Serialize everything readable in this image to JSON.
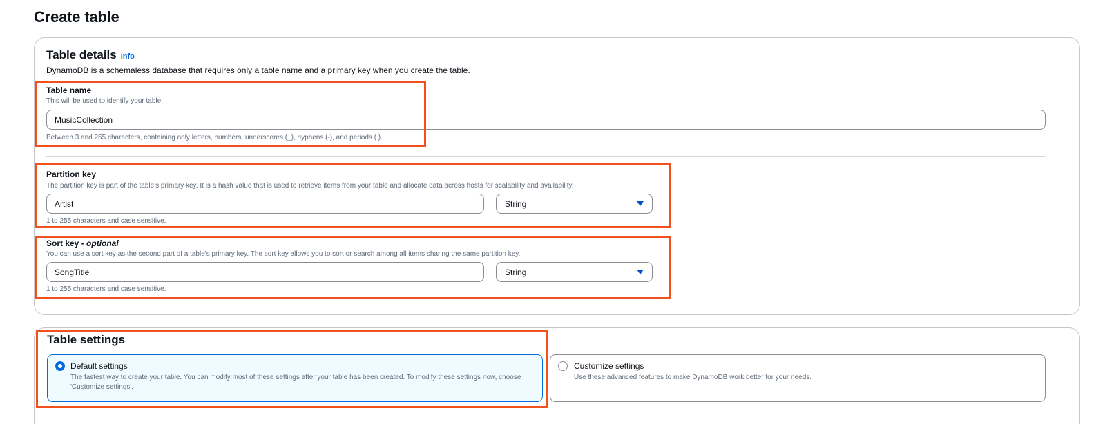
{
  "page": {
    "title": "Create table"
  },
  "table_details": {
    "title": "Table details",
    "info_link": "Info",
    "description": "DynamoDB is a schemaless database that requires only a table name and a primary key when you create the table.",
    "table_name": {
      "label": "Table name",
      "hint": "This will be used to identify your table.",
      "value": "MusicCollection",
      "constraint": "Between 3 and 255 characters, containing only letters, numbers, underscores (_), hyphens (-), and periods (.)."
    },
    "partition_key": {
      "label": "Partition key",
      "hint": "The partition key is part of the table's primary key. It is a hash value that is used to retrieve items from your table and allocate data across hosts for scalability and availability.",
      "value": "Artist",
      "type": "String",
      "constraint": "1 to 255 characters and case sensitive."
    },
    "sort_key": {
      "label": "Sort key",
      "label_suffix": "optional",
      "hint": "You can use a sort key as the second part of a table's primary key. The sort key allows you to sort or search among all items sharing the same partition key.",
      "value": "SongTitle",
      "type": "String",
      "constraint": "1 to 255 characters and case sensitive."
    }
  },
  "table_settings": {
    "title": "Table settings",
    "options": [
      {
        "title": "Default settings",
        "description": "The fastest way to create your table. You can modify most of these settings after your table has been created. To modify these settings now, choose 'Customize settings'.",
        "selected": true
      },
      {
        "title": "Customize settings",
        "description": "Use these advanced features to make DynamoDB work better for your needs.",
        "selected": false
      }
    ]
  },
  "colors": {
    "accent": "#006ce0",
    "highlight": "#f2501c",
    "selected_tile_bg": "#f0fbff"
  }
}
